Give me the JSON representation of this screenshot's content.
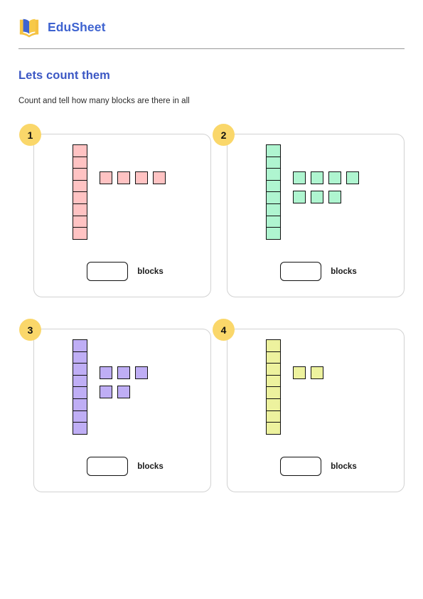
{
  "header": {
    "logo_icon": "open-book-icon",
    "logo_colors": {
      "cover": "#f5c242",
      "left_page": "#3e63d0",
      "right_page": "#f7c948"
    },
    "brand_name": "EduSheet"
  },
  "worksheet": {
    "title": "Lets count them",
    "instruction": "Count and tell how many blocks are there in all",
    "title_color": "#3b57c4",
    "badge_color": "#fad76a"
  },
  "answer": {
    "label": "blocks",
    "value": "",
    "placeholder": ""
  },
  "cards": [
    {
      "badge": "1",
      "color": "#ffc3c3",
      "tower_count": 8,
      "loose_rows": [
        4
      ],
      "loose_total": 4,
      "total": 12
    },
    {
      "badge": "2",
      "color": "#aff5d0",
      "tower_count": 8,
      "loose_rows": [
        4,
        3
      ],
      "loose_total": 7,
      "total": 15
    },
    {
      "badge": "3",
      "color": "#bfaef5",
      "tower_count": 8,
      "loose_rows": [
        3,
        2
      ],
      "loose_total": 5,
      "total": 13
    },
    {
      "badge": "4",
      "color": "#edf29e",
      "tower_count": 8,
      "loose_rows": [
        2
      ],
      "loose_total": 2,
      "total": 10
    }
  ]
}
